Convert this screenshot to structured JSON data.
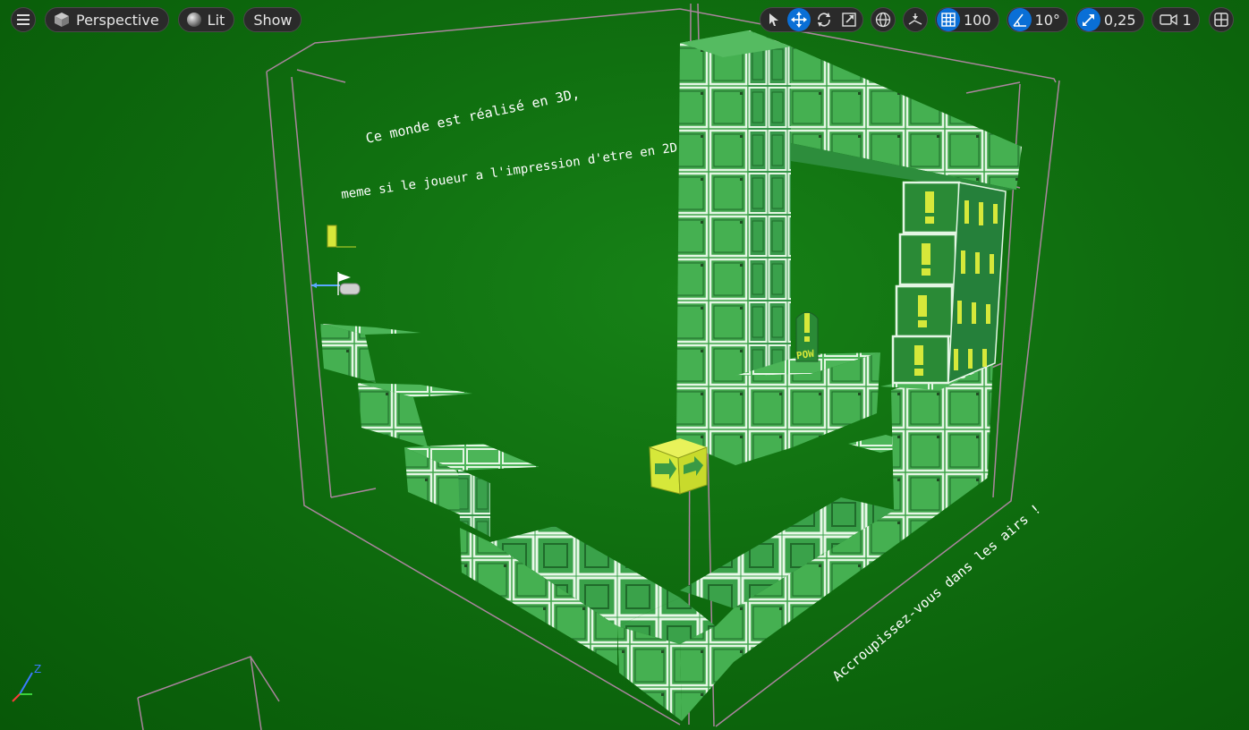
{
  "toolbar": {
    "view_mode": "Perspective",
    "lighting": "Lit",
    "show": "Show",
    "grid_snap_value": "100",
    "rotation_snap_value": "10°",
    "scale_snap_value": "0,25",
    "camera_speed_value": "1"
  },
  "icons": {
    "menu": "hamburger-menu-icon",
    "perspective": "cube-icon",
    "lit": "sphere-icon",
    "select": "cursor-arrow-icon",
    "translate": "move-arrows-icon",
    "rotate": "rotate-icon",
    "scale": "scale-icon",
    "world": "globe-icon",
    "surface_snap": "surface-snapping-icon",
    "grid": "grid-icon",
    "angle": "angle-icon",
    "scale_snap": "scale-arrow-icon",
    "camera": "camera-icon",
    "layout": "layout-grid-icon"
  },
  "scene": {
    "text_line1": "Ce monde est réalisé en 3D,",
    "text_line2": "meme si le joueur a l'impression d'etre en 2D",
    "text_floor": "Accroupissez-vous dans les airs !",
    "pow_label": "POW",
    "axis_z": "Z"
  },
  "colors": {
    "background": "#0f6d0f",
    "block": "#3fa54a",
    "block_edge": "#d8f0d8",
    "block_shadow": "#1f6b2a",
    "yellow_block": "#d6e83a",
    "accent_blue": "#0a6fd6",
    "wire": "#c78ab8"
  }
}
